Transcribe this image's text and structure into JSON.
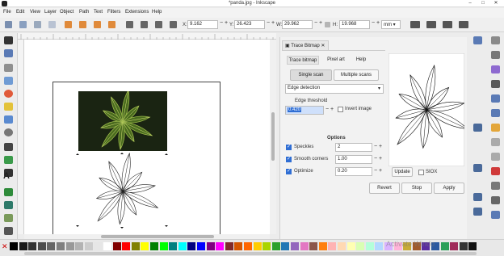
{
  "window": {
    "title": "*panda.jpg - Inkscape"
  },
  "menu": [
    "File",
    "Edit",
    "View",
    "Layer",
    "Object",
    "Path",
    "Text",
    "Filters",
    "Extensions",
    "Help"
  ],
  "toolbar": {
    "x_label": "X:",
    "x_value": "9.162",
    "y_label": "Y:",
    "y_value": "26.423",
    "w_label": "W:",
    "w_value": "29.962",
    "h_label": "H:",
    "h_value": "19.968",
    "unit": "mm"
  },
  "dock": {
    "tab_title": "Trace Bitmap",
    "tabs": [
      "Trace bitmap",
      "Pixel art",
      "Help"
    ],
    "scan_modes": [
      "Single scan",
      "Multiple scans"
    ],
    "detection_mode": "Edge detection",
    "threshold_label": "Edge threshold",
    "threshold_value": "0.420",
    "invert_label": "Invert image",
    "options_heading": "Options",
    "options": [
      {
        "label": "Speckles",
        "value": "2"
      },
      {
        "label": "Smooth corners",
        "value": "1.00"
      },
      {
        "label": "Optimize",
        "value": "0.20"
      }
    ],
    "update_label": "Update",
    "sioX_label": "SIOX",
    "revert_label": "Revert",
    "stop_label": "Stop",
    "apply_label": "Apply"
  },
  "colors": {
    "accent": "#2f6ed4",
    "leaf_dark": "#1d2a14",
    "leaf_green": "#4a6b1f"
  },
  "watermark": "Activate Windo"
}
